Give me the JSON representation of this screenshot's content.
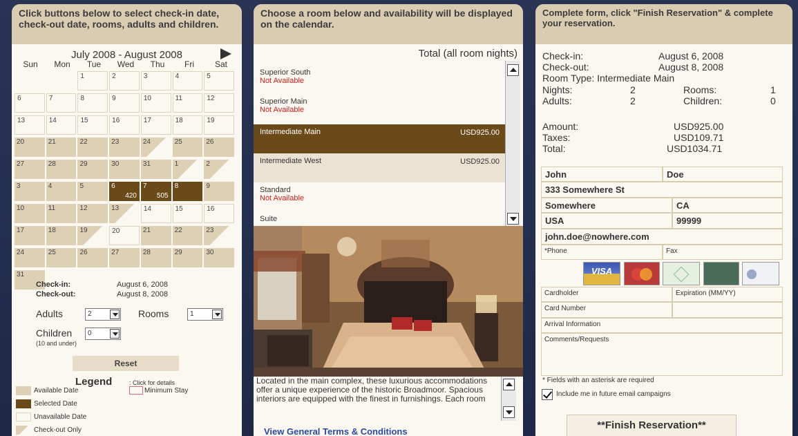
{
  "panel1": {
    "header": "Click buttons below to select check-in date, check-out date, rooms, adults and children.",
    "calendar_title": "July 2008 - August 2008",
    "days_of_week": [
      "Sun",
      "Mon",
      "Tue",
      "Wed",
      "Thu",
      "Fri",
      "Sat"
    ],
    "weeks": [
      [
        {
          "d": ""
        },
        {
          "d": ""
        },
        {
          "d": "1",
          "s": "unavail"
        },
        {
          "d": "2",
          "s": "unavail"
        },
        {
          "d": "3",
          "s": "unavail"
        },
        {
          "d": "4",
          "s": "unavail"
        },
        {
          "d": "5",
          "s": "unavail"
        }
      ],
      [
        {
          "d": "6",
          "s": "unavail"
        },
        {
          "d": "7",
          "s": "unavail"
        },
        {
          "d": "8",
          "s": "unavail"
        },
        {
          "d": "9",
          "s": "unavail"
        },
        {
          "d": "10",
          "s": "unavail"
        },
        {
          "d": "11",
          "s": "unavail"
        },
        {
          "d": "12",
          "s": "unavail"
        }
      ],
      [
        {
          "d": "13",
          "s": "unavail"
        },
        {
          "d": "14",
          "s": "unavail"
        },
        {
          "d": "15",
          "s": "unavail"
        },
        {
          "d": "16",
          "s": "unavail"
        },
        {
          "d": "17",
          "s": "unavail"
        },
        {
          "d": "18",
          "s": "unavail"
        },
        {
          "d": "19",
          "s": "unavail"
        }
      ],
      [
        {
          "d": "20",
          "s": "avail"
        },
        {
          "d": "21",
          "s": "avail"
        },
        {
          "d": "22",
          "s": "avail"
        },
        {
          "d": "23",
          "s": "avail"
        },
        {
          "d": "24",
          "s": "checkout"
        },
        {
          "d": "25",
          "s": "avail"
        },
        {
          "d": "26",
          "s": "avail"
        }
      ],
      [
        {
          "d": "27",
          "s": "avail"
        },
        {
          "d": "28",
          "s": "avail"
        },
        {
          "d": "29",
          "s": "avail"
        },
        {
          "d": "30",
          "s": "avail"
        },
        {
          "d": "31",
          "s": "avail"
        },
        {
          "d": "1",
          "s": "checkout"
        },
        {
          "d": "2",
          "s": "checkout"
        }
      ],
      [
        {
          "d": "3",
          "s": "avail"
        },
        {
          "d": "4",
          "s": "avail"
        },
        {
          "d": "5",
          "s": "avail"
        },
        {
          "d": "6",
          "s": "selected",
          "p": "420"
        },
        {
          "d": "7",
          "s": "selected",
          "p": "505"
        },
        {
          "d": "8",
          "s": "selected"
        },
        {
          "d": "9",
          "s": "avail"
        }
      ],
      [
        {
          "d": "10",
          "s": "avail"
        },
        {
          "d": "11",
          "s": "avail"
        },
        {
          "d": "12",
          "s": "avail"
        },
        {
          "d": "13",
          "s": "checkout"
        },
        {
          "d": "14",
          "s": "unavail"
        },
        {
          "d": "15",
          "s": "unavail"
        },
        {
          "d": "16",
          "s": "unavail"
        }
      ],
      [
        {
          "d": "17",
          "s": "avail"
        },
        {
          "d": "18",
          "s": "avail"
        },
        {
          "d": "19",
          "s": "checkout"
        },
        {
          "d": "20",
          "s": "unavail"
        },
        {
          "d": "21",
          "s": "avail"
        },
        {
          "d": "22",
          "s": "avail"
        },
        {
          "d": "23",
          "s": "checkout"
        }
      ],
      [
        {
          "d": "24",
          "s": "avail"
        },
        {
          "d": "25",
          "s": "avail"
        },
        {
          "d": "26",
          "s": "avail"
        },
        {
          "d": "27",
          "s": "avail"
        },
        {
          "d": "28",
          "s": "avail"
        },
        {
          "d": "29",
          "s": "avail"
        },
        {
          "d": "30",
          "s": "avail"
        }
      ],
      [
        {
          "d": "31",
          "s": "avail"
        }
      ]
    ],
    "checkin_label": "Check-in:",
    "checkin_value": "August 6, 2008",
    "checkout_label": "Check-out:",
    "checkout_value": "August 8, 2008",
    "adults_label": "Adults",
    "adults_value": "2",
    "rooms_label": "Rooms",
    "rooms_value": "1",
    "children_label": "Children",
    "children_value": "0",
    "children_note": "(10 and under)",
    "reset_label": "Reset",
    "legend_title": "Legend",
    "legend_hint": ": Click for details",
    "legend_min_stay": "Minimum Stay",
    "legend_items": [
      "Available Date",
      "Selected Date",
      "Unavailable Date",
      "Check-out Only"
    ]
  },
  "panel2": {
    "header": "Choose a room below and availability will be displayed on the calendar.",
    "total_label": "Total (all room nights)",
    "rooms": [
      {
        "name": "Superior South",
        "status": "Not Available",
        "price": ""
      },
      {
        "name": "Superior Main",
        "status": "Not Available",
        "price": ""
      },
      {
        "name": "Intermediate Main",
        "status": "",
        "price": "USD925.00"
      },
      {
        "name": "Intermediate West",
        "status": "",
        "price": "USD925.00"
      },
      {
        "name": "Standard",
        "status": "Not Available",
        "price": ""
      },
      {
        "name": "Suite",
        "status": "",
        "price": ""
      }
    ],
    "description": "Located in the main complex, these luxurious accommodations offer a unique experience of the historic Broadmoor.  Spacious interiors are equipped with the finest in furnishings.  Each room",
    "terms_link": "View General Terms & Conditions"
  },
  "panel3": {
    "header": "Complete form, click \"Finish Reservation\" & complete your reservation.",
    "checkin_label": "Check-in:",
    "checkin_value": "August 6, 2008",
    "checkout_label": "Check-out:",
    "checkout_value": "August 8, 2008",
    "room_type": "Room Type: Intermediate Main",
    "nights_label": "Nights:",
    "nights_value": "2",
    "rooms_label": "Rooms:",
    "rooms_value": "1",
    "adults_label": "Adults:",
    "adults_value": "2",
    "children_label": "Children:",
    "children_value": "0",
    "amount_label": "Amount:",
    "amount_value": "USD925.00",
    "taxes_label": "Taxes:",
    "taxes_value": "USD109.71",
    "total_label": "Total:",
    "total_value": "USD1034.71",
    "first_name": "John",
    "last_name": "Doe",
    "street": "333 Somewhere St",
    "city": "Somewhere",
    "state": "CA",
    "country": "USA",
    "zip": "99999",
    "email": "john.doe@nowhere.com",
    "phone_placeholder": "*Phone",
    "fax_placeholder": "Fax",
    "card_labels": [
      "VISA",
      "MasterCard",
      "",
      "",
      ""
    ],
    "cardholder_placeholder": "Cardholder",
    "expiration_placeholder": "Expiration (MM/YY)",
    "card_number_placeholder": "Card Number",
    "arrival_placeholder": "Arrival Information",
    "comments_placeholder": "Comments/Requests",
    "required_note": "* Fields with an asterisk are required",
    "email_optin": "Include me in future email campaigns",
    "finish_label": "**Finish Reservation**"
  },
  "colors": {
    "header_bg": "#d9ccb0",
    "available": "#ddd0b4",
    "selected": "#6b4a19",
    "not_available": "#d0201c",
    "link": "#2a4aa0"
  }
}
